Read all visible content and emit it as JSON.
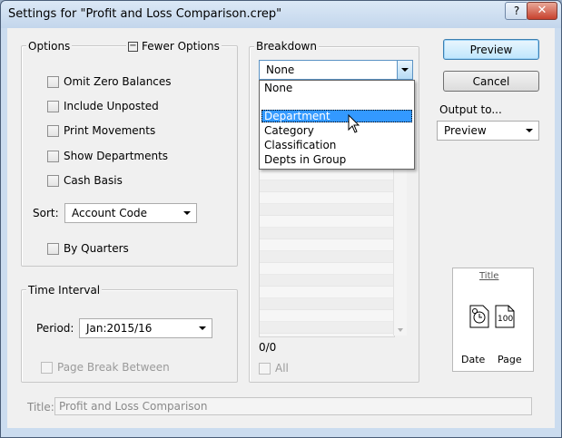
{
  "window": {
    "title": "Settings for \"Profit and Loss Comparison.crep\"",
    "help_label": "?",
    "close_label": "✕"
  },
  "options": {
    "legend": "Options",
    "fewer_options_label": "Fewer Options",
    "fewer_options_glyph": "−",
    "checkboxes": [
      "Omit Zero Balances",
      "Include Unposted",
      "Print Movements",
      "Show Departments",
      "Cash Basis"
    ],
    "sort_label": "Sort:",
    "sort_value": "Account Code",
    "by_quarters": "By Quarters"
  },
  "time_interval": {
    "legend": "Time Interval",
    "period_label": "Period:",
    "period_value": "Jan:2015/16",
    "page_break": "Page Break Between"
  },
  "breakdown": {
    "legend": "Breakdown",
    "selected": "None",
    "dropdown_items": [
      "None",
      "",
      "Department",
      "Category",
      "Classification",
      "Depts in Group"
    ],
    "highlighted_index": 2,
    "count": "0/0",
    "all_label": "All"
  },
  "buttons": {
    "preview": "Preview",
    "cancel": "Cancel"
  },
  "output": {
    "label": "Output to...",
    "value": "Preview"
  },
  "page_preview": {
    "title": "Title",
    "date": "Date",
    "page": "Page",
    "page_number": "100"
  },
  "title_field": {
    "label": "Title:",
    "value": "Profit and Loss Comparison"
  },
  "colors": {
    "selection": "#3399ff",
    "default_button": "#3c7fb1"
  }
}
